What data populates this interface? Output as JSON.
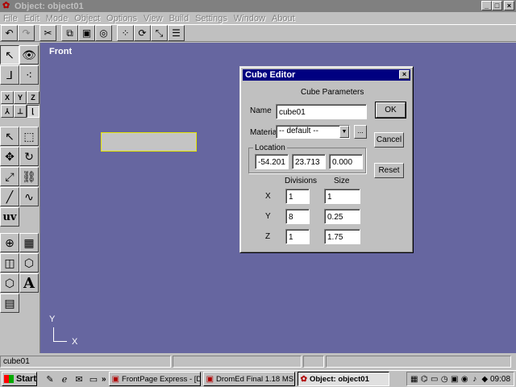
{
  "window": {
    "title": "Object: object01",
    "icon": "app-red-icon",
    "minimize": "_",
    "maximize": "□",
    "close": "×"
  },
  "menu": [
    "File",
    "Edit",
    "Mode",
    "Object",
    "Options",
    "View",
    "Build",
    "Settings",
    "Window",
    "About"
  ],
  "toolbar_icons": [
    "undo-icon",
    "redo-icon",
    "cut-icon",
    "copy-icon",
    "paste-icon",
    "disc-icon",
    "grid-icon",
    "rotate-icon",
    "snap-icon",
    "list-icon"
  ],
  "palette": {
    "axis_x": "X",
    "axis_y": "Y",
    "axis_z": "Z",
    "uv_label": "uv",
    "text_label": "A"
  },
  "viewport": {
    "label": "Front",
    "axis_y": "Y",
    "axis_x": "X"
  },
  "dialog": {
    "title": "Cube Editor",
    "close": "×",
    "section": "Cube Parameters",
    "name_label": "Name",
    "name_value": "cube01",
    "material_label": "Material",
    "material_value": "-- default --",
    "browse": "...",
    "location_label": "Location",
    "location": [
      "-54.201",
      "23.713",
      "0.000"
    ],
    "divisions_label": "Divisions",
    "size_label": "Size",
    "axes": [
      "X",
      "Y",
      "Z"
    ],
    "divisions": [
      "1",
      "8",
      "1"
    ],
    "sizes": [
      "1",
      "0.25",
      "1.75"
    ],
    "ok": "OK",
    "cancel": "Cancel",
    "reset": "Reset"
  },
  "statusbar": {
    "object": "cube01"
  },
  "taskbar": {
    "start": "Start",
    "chevron": "»",
    "tasks": [
      {
        "label": "FrontPage Express - [D...",
        "icon": "frontpage-icon",
        "active": false
      },
      {
        "label": "DromEd Final 1.18 MS...",
        "icon": "dromed-icon",
        "active": false
      },
      {
        "label": "Object: object01",
        "icon": "app-red-icon",
        "active": true
      }
    ],
    "clock": "09:08"
  }
}
